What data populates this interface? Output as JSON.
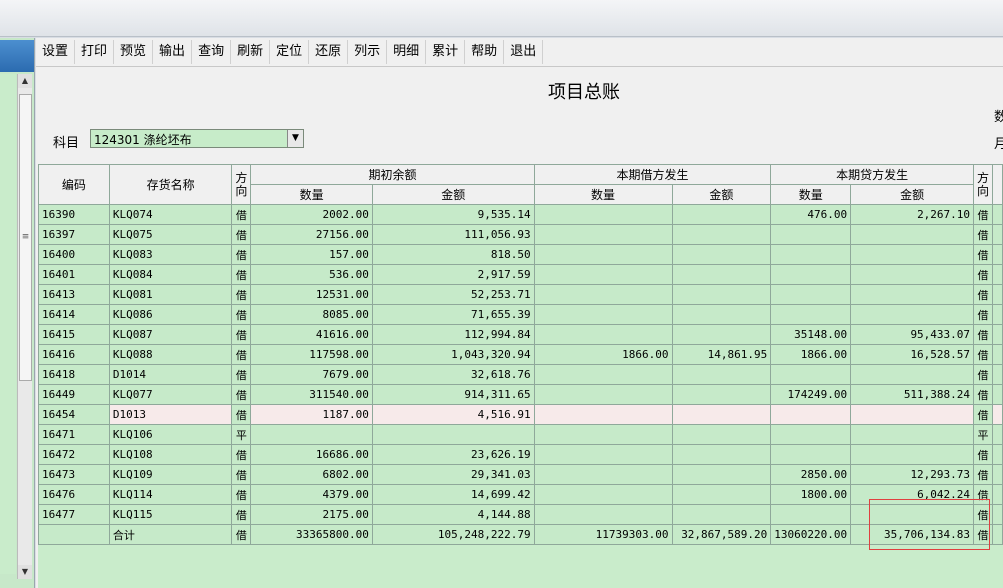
{
  "menu": [
    "设置",
    "打印",
    "预览",
    "输出",
    "查询",
    "刷新",
    "定位",
    "还原",
    "列示",
    "明细",
    "累计",
    "帮助",
    "退出"
  ],
  "report_title": "项目总账",
  "right_cut": [
    "数",
    "月"
  ],
  "subject": {
    "label": "科目",
    "value": "124301 涤纶坯布"
  },
  "headers": {
    "code": "编码",
    "name": "存货名称",
    "direction": "方向",
    "opening": "期初余额",
    "debit": "本期借方发生",
    "credit": "本期贷方发生",
    "qty": "数量",
    "amount": "金额"
  },
  "rows": [
    {
      "code": "16390",
      "name": "KLQ074",
      "dir": "借",
      "oq": "2002.00",
      "oa": "9,535.14",
      "dq": "",
      "da": "",
      "cq": "476.00",
      "ca": "2,267.10",
      "dir2": "借"
    },
    {
      "code": "16397",
      "name": "KLQ075",
      "dir": "借",
      "oq": "27156.00",
      "oa": "111,056.93",
      "dq": "",
      "da": "",
      "cq": "",
      "ca": "",
      "dir2": "借"
    },
    {
      "code": "16400",
      "name": "KLQ083",
      "dir": "借",
      "oq": "157.00",
      "oa": "818.50",
      "dq": "",
      "da": "",
      "cq": "",
      "ca": "",
      "dir2": "借"
    },
    {
      "code": "16401",
      "name": "KLQ084",
      "dir": "借",
      "oq": "536.00",
      "oa": "2,917.59",
      "dq": "",
      "da": "",
      "cq": "",
      "ca": "",
      "dir2": "借"
    },
    {
      "code": "16413",
      "name": "KLQ081",
      "dir": "借",
      "oq": "12531.00",
      "oa": "52,253.71",
      "dq": "",
      "da": "",
      "cq": "",
      "ca": "",
      "dir2": "借"
    },
    {
      "code": "16414",
      "name": "KLQ086",
      "dir": "借",
      "oq": "8085.00",
      "oa": "71,655.39",
      "dq": "",
      "da": "",
      "cq": "",
      "ca": "",
      "dir2": "借"
    },
    {
      "code": "16415",
      "name": "KLQ087",
      "dir": "借",
      "oq": "41616.00",
      "oa": "112,994.84",
      "dq": "",
      "da": "",
      "cq": "35148.00",
      "ca": "95,433.07",
      "dir2": "借"
    },
    {
      "code": "16416",
      "name": "KLQ088",
      "dir": "借",
      "oq": "117598.00",
      "oa": "1,043,320.94",
      "dq": "1866.00",
      "da": "14,861.95",
      "cq": "1866.00",
      "ca": "16,528.57",
      "dir2": "借"
    },
    {
      "code": "16418",
      "name": "D1014",
      "dir": "借",
      "oq": "7679.00",
      "oa": "32,618.76",
      "dq": "",
      "da": "",
      "cq": "",
      "ca": "",
      "dir2": "借"
    },
    {
      "code": "16449",
      "name": "KLQ077",
      "dir": "借",
      "oq": "311540.00",
      "oa": "914,311.65",
      "dq": "",
      "da": "",
      "cq": "174249.00",
      "ca": "511,388.24",
      "dir2": "借"
    },
    {
      "code": "16454",
      "name": "D1013",
      "dir": "借",
      "oq": "1187.00",
      "oa": "4,516.91",
      "dq": "",
      "da": "",
      "cq": "",
      "ca": "",
      "dir2": "借",
      "selected": true
    },
    {
      "code": "16471",
      "name": "KLQ106",
      "dir": "平",
      "oq": "",
      "oa": "",
      "dq": "",
      "da": "",
      "cq": "",
      "ca": "",
      "dir2": "平"
    },
    {
      "code": "16472",
      "name": "KLQ108",
      "dir": "借",
      "oq": "16686.00",
      "oa": "23,626.19",
      "dq": "",
      "da": "",
      "cq": "",
      "ca": "",
      "dir2": "借"
    },
    {
      "code": "16473",
      "name": "KLQ109",
      "dir": "借",
      "oq": "6802.00",
      "oa": "29,341.03",
      "dq": "",
      "da": "",
      "cq": "2850.00",
      "ca": "12,293.73",
      "dir2": "借"
    },
    {
      "code": "16476",
      "name": "KLQ114",
      "dir": "借",
      "oq": "4379.00",
      "oa": "14,699.42",
      "dq": "",
      "da": "",
      "cq": "1800.00",
      "ca": "6,042.24",
      "dir2": "借"
    },
    {
      "code": "16477",
      "name": "KLQ115",
      "dir": "借",
      "oq": "2175.00",
      "oa": "4,144.88",
      "dq": "",
      "da": "",
      "cq": "",
      "ca": "",
      "dir2": "借"
    },
    {
      "code": "",
      "name": "合计",
      "dir": "借",
      "oq": "33365800.00",
      "oa": "105,248,222.79",
      "dq": "11739303.00",
      "da": "32,867,589.20",
      "cq": "13060220.00",
      "ca": "35,706,134.83",
      "dir2": "借"
    }
  ]
}
